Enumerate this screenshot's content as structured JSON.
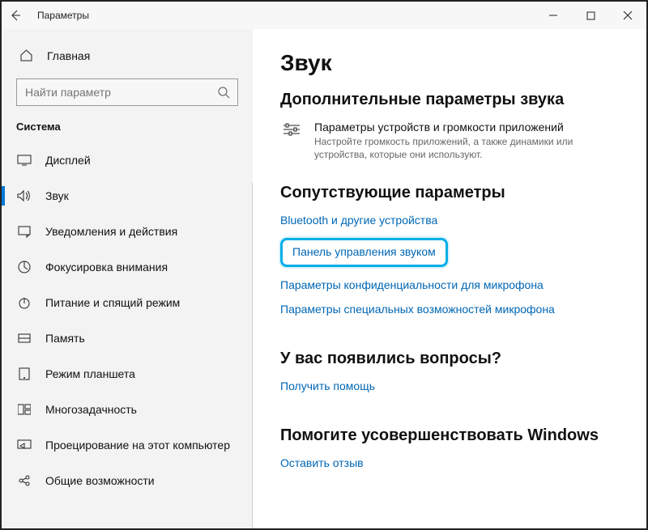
{
  "window": {
    "title": "Параметры"
  },
  "sidebar": {
    "home_label": "Главная",
    "search_placeholder": "Найти параметр",
    "group_label": "Система",
    "items": [
      {
        "label": "Дисплей"
      },
      {
        "label": "Звук"
      },
      {
        "label": "Уведомления и действия"
      },
      {
        "label": "Фокусировка внимания"
      },
      {
        "label": "Питание и спящий режим"
      },
      {
        "label": "Память"
      },
      {
        "label": "Режим планшета"
      },
      {
        "label": "Многозадачность"
      },
      {
        "label": "Проецирование на этот компьютер"
      },
      {
        "label": "Общие возможности"
      }
    ]
  },
  "main": {
    "page_title": "Звук",
    "advanced_heading": "Дополнительные параметры звука",
    "device_card": {
      "title": "Параметры устройств и громкости приложений",
      "subtitle": "Настройте громкость приложений, а также динамики или устройства, которые они используют."
    },
    "related_heading": "Сопутствующие параметры",
    "related_links": [
      "Bluetooth и другие устройства",
      "Панель управления звуком",
      "Параметры конфиденциальности для микрофона",
      "Параметры специальных возможностей микрофона"
    ],
    "related_highlight_index": 1,
    "help_heading": "У вас появились вопросы?",
    "help_link": "Получить помощь",
    "feedback_heading": "Помогите усовершенствовать Windows",
    "feedback_link": "Оставить отзыв"
  },
  "colors": {
    "accent": "#0078d4",
    "link": "#0066b4",
    "highlight": "#00aee6"
  }
}
